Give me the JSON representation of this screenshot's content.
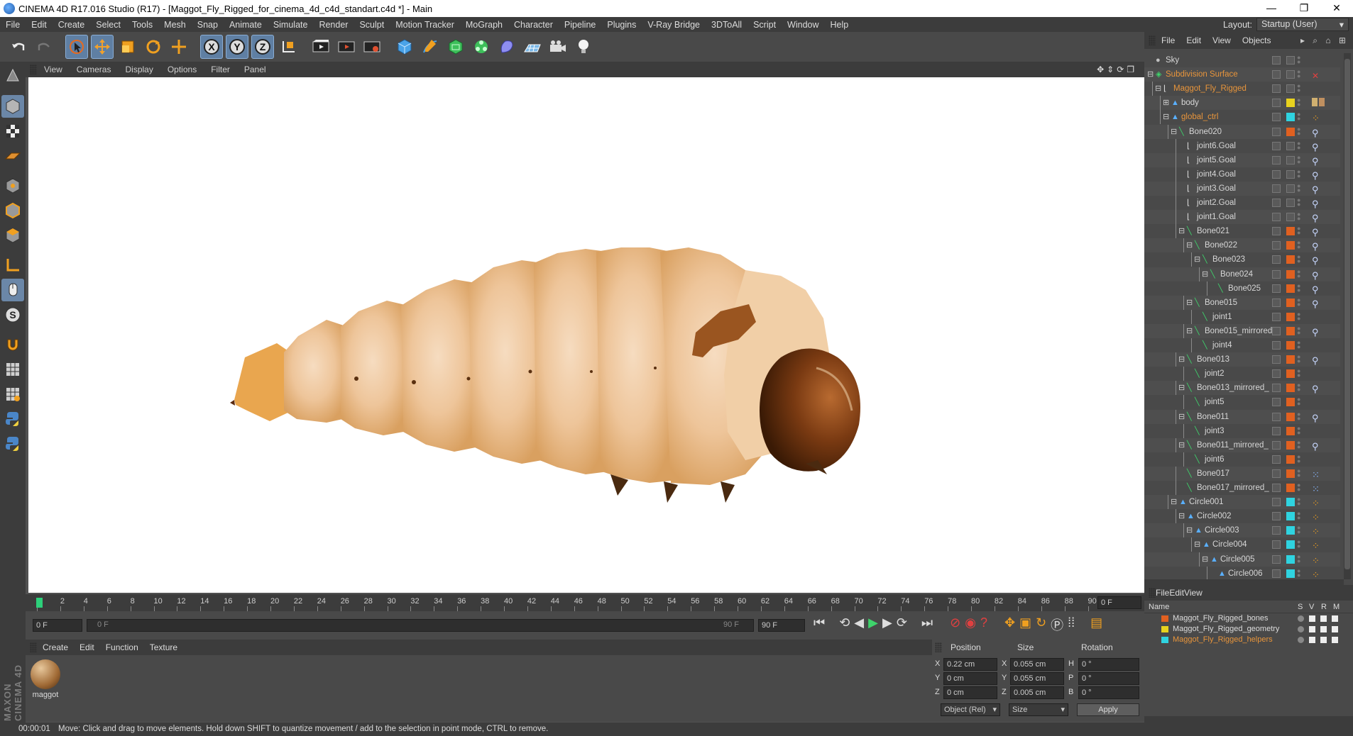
{
  "window": {
    "title": "CINEMA 4D R17.016 Studio (R17) - [Maggot_Fly_Rigged_for_cinema_4d_c4d_standart.c4d *] - Main",
    "controls": [
      "—",
      "❐",
      "✕"
    ]
  },
  "menubar": {
    "items": [
      "File",
      "Edit",
      "Create",
      "Select",
      "Tools",
      "Mesh",
      "Snap",
      "Animate",
      "Simulate",
      "Render",
      "Sculpt",
      "Motion Tracker",
      "MoGraph",
      "Character",
      "Pipeline",
      "Plugins",
      "V-Ray Bridge",
      "3DToAll",
      "Script",
      "Window",
      "Help"
    ],
    "layout_label": "Layout:",
    "layout_value": "Startup (User)"
  },
  "viewport": {
    "menu": [
      "View",
      "Cameras",
      "Display",
      "Options",
      "Filter",
      "Panel"
    ],
    "nav_icons": "✥⇕⟳❐"
  },
  "timeline": {
    "ticks": [
      "0",
      "2",
      "4",
      "6",
      "8",
      "10",
      "12",
      "14",
      "16",
      "18",
      "20",
      "22",
      "24",
      "26",
      "28",
      "30",
      "32",
      "34",
      "36",
      "38",
      "40",
      "42",
      "44",
      "46",
      "48",
      "50",
      "52",
      "54",
      "56",
      "58",
      "60",
      "62",
      "64",
      "66",
      "68",
      "70",
      "72",
      "74",
      "76",
      "78",
      "80",
      "82",
      "84",
      "86",
      "88",
      "90"
    ],
    "current_frame": "0 F",
    "start_field": "0 F",
    "range_start": "0 F",
    "range_end": "90 F",
    "end_field": "90 F"
  },
  "materials": {
    "menu": [
      "Create",
      "Edit",
      "Function",
      "Texture"
    ],
    "items": [
      {
        "name": "maggot"
      }
    ]
  },
  "attributes": {
    "headers": {
      "position": "Position",
      "size": "Size",
      "rotation": "Rotation"
    },
    "rows": [
      {
        "axis": "X",
        "pos": "0.22 cm",
        "saxis": "X",
        "size": "0.055 cm",
        "raxis": "H",
        "rot": "0 °"
      },
      {
        "axis": "Y",
        "pos": "0 cm",
        "saxis": "Y",
        "size": "0.055 cm",
        "raxis": "P",
        "rot": "0 °"
      },
      {
        "axis": "Z",
        "pos": "0 cm",
        "saxis": "Z",
        "size": "0.005 cm",
        "raxis": "B",
        "rot": "0 °"
      }
    ],
    "coord_mode": "Object (Rel)",
    "size_mode": "Size",
    "apply": "Apply"
  },
  "objects": {
    "menu": [
      "File",
      "Edit",
      "View",
      "Objects"
    ],
    "items": [
      {
        "name": "Sky",
        "depth": 0,
        "exp": "",
        "color": "#5a5a5a",
        "orange": false,
        "tag": "none"
      },
      {
        "name": "Subdivision Surface",
        "depth": 0,
        "exp": "−",
        "color": "#5a5a5a",
        "orange": true,
        "tag": "x"
      },
      {
        "name": "Maggot_Fly_Rigged",
        "depth": 1,
        "exp": "−",
        "color": "#5a5a5a",
        "orange": true,
        "tag": "none"
      },
      {
        "name": "body",
        "depth": 2,
        "exp": "+",
        "color": "#e8d21e",
        "orange": false,
        "tag": "mat"
      },
      {
        "name": "global_ctrl",
        "depth": 2,
        "exp": "−",
        "color": "#2fd3e0",
        "orange": true,
        "tag": "pt"
      },
      {
        "name": "Bone020",
        "depth": 3,
        "exp": "−",
        "color": "#e06020",
        "orange": false,
        "tag": "ik"
      },
      {
        "name": "joint6.Goal",
        "depth": 4,
        "exp": "",
        "color": "#5a5a5a",
        "orange": false,
        "tag": "ik"
      },
      {
        "name": "joint5.Goal",
        "depth": 4,
        "exp": "",
        "color": "#5a5a5a",
        "orange": false,
        "tag": "ik"
      },
      {
        "name": "joint4.Goal",
        "depth": 4,
        "exp": "",
        "color": "#5a5a5a",
        "orange": false,
        "tag": "ik"
      },
      {
        "name": "joint3.Goal",
        "depth": 4,
        "exp": "",
        "color": "#5a5a5a",
        "orange": false,
        "tag": "ik"
      },
      {
        "name": "joint2.Goal",
        "depth": 4,
        "exp": "",
        "color": "#5a5a5a",
        "orange": false,
        "tag": "ik"
      },
      {
        "name": "joint1.Goal",
        "depth": 4,
        "exp": "",
        "color": "#5a5a5a",
        "orange": false,
        "tag": "ik"
      },
      {
        "name": "Bone021",
        "depth": 4,
        "exp": "−",
        "color": "#e06020",
        "orange": false,
        "tag": "ik"
      },
      {
        "name": "Bone022",
        "depth": 5,
        "exp": "−",
        "color": "#e06020",
        "orange": false,
        "tag": "ik"
      },
      {
        "name": "Bone023",
        "depth": 6,
        "exp": "−",
        "color": "#e06020",
        "orange": false,
        "tag": "ik"
      },
      {
        "name": "Bone024",
        "depth": 7,
        "exp": "−",
        "color": "#e06020",
        "orange": false,
        "tag": "ik"
      },
      {
        "name": "Bone025",
        "depth": 8,
        "exp": "",
        "color": "#e06020",
        "orange": false,
        "tag": "ik"
      },
      {
        "name": "Bone015",
        "depth": 5,
        "exp": "−",
        "color": "#e06020",
        "orange": false,
        "tag": "ik"
      },
      {
        "name": "joint1",
        "depth": 6,
        "exp": "",
        "color": "#e06020",
        "orange": false,
        "tag": "none"
      },
      {
        "name": "Bone015_mirrored_",
        "depth": 5,
        "exp": "−",
        "color": "#e06020",
        "orange": false,
        "tag": "ik"
      },
      {
        "name": "joint4",
        "depth": 6,
        "exp": "",
        "color": "#e06020",
        "orange": false,
        "tag": "none"
      },
      {
        "name": "Bone013",
        "depth": 4,
        "exp": "−",
        "color": "#e06020",
        "orange": false,
        "tag": "ik"
      },
      {
        "name": "joint2",
        "depth": 5,
        "exp": "",
        "color": "#e06020",
        "orange": false,
        "tag": "none"
      },
      {
        "name": "Bone013_mirrored_",
        "depth": 4,
        "exp": "−",
        "color": "#e06020",
        "orange": false,
        "tag": "ik"
      },
      {
        "name": "joint5",
        "depth": 5,
        "exp": "",
        "color": "#e06020",
        "orange": false,
        "tag": "none"
      },
      {
        "name": "Bone011",
        "depth": 4,
        "exp": "−",
        "color": "#e06020",
        "orange": false,
        "tag": "ik"
      },
      {
        "name": "joint3",
        "depth": 5,
        "exp": "",
        "color": "#e06020",
        "orange": false,
        "tag": "none"
      },
      {
        "name": "Bone011_mirrored_",
        "depth": 4,
        "exp": "−",
        "color": "#e06020",
        "orange": false,
        "tag": "ik"
      },
      {
        "name": "joint6",
        "depth": 5,
        "exp": "",
        "color": "#e06020",
        "orange": false,
        "tag": "none"
      },
      {
        "name": "Bone017",
        "depth": 4,
        "exp": "",
        "color": "#e06020",
        "orange": false,
        "tag": "dots"
      },
      {
        "name": "Bone017_mirrored_",
        "depth": 4,
        "exp": "",
        "color": "#e06020",
        "orange": false,
        "tag": "dots"
      },
      {
        "name": "Circle001",
        "depth": 3,
        "exp": "−",
        "color": "#2fd3e0",
        "orange": false,
        "tag": "pt"
      },
      {
        "name": "Circle002",
        "depth": 4,
        "exp": "−",
        "color": "#2fd3e0",
        "orange": false,
        "tag": "pt"
      },
      {
        "name": "Circle003",
        "depth": 5,
        "exp": "−",
        "color": "#2fd3e0",
        "orange": false,
        "tag": "pt"
      },
      {
        "name": "Circle004",
        "depth": 6,
        "exp": "−",
        "color": "#2fd3e0",
        "orange": false,
        "tag": "pt"
      },
      {
        "name": "Circle005",
        "depth": 7,
        "exp": "−",
        "color": "#2fd3e0",
        "orange": false,
        "tag": "pt"
      },
      {
        "name": "Circle006",
        "depth": 8,
        "exp": "",
        "color": "#2fd3e0",
        "orange": false,
        "tag": "pt"
      }
    ]
  },
  "layers": {
    "menu": [
      "File",
      "Edit",
      "View"
    ],
    "col_name": "Name",
    "cols": [
      "S",
      "V",
      "R",
      "M"
    ],
    "items": [
      {
        "name": "Maggot_Fly_Rigged_bones",
        "color": "#e06020",
        "active": false
      },
      {
        "name": "Maggot_Fly_Rigged_geometry",
        "color": "#e8d21e",
        "active": false
      },
      {
        "name": "Maggot_Fly_Rigged_helpers",
        "color": "#2fd3e0",
        "active": true
      }
    ]
  },
  "status": {
    "time": "00:00:01",
    "message": "Move: Click and drag to move elements. Hold down SHIFT to quantize movement / add to the selection in point mode, CTRL to remove."
  },
  "brand": {
    "text": "MAXON CINEMA 4D"
  }
}
